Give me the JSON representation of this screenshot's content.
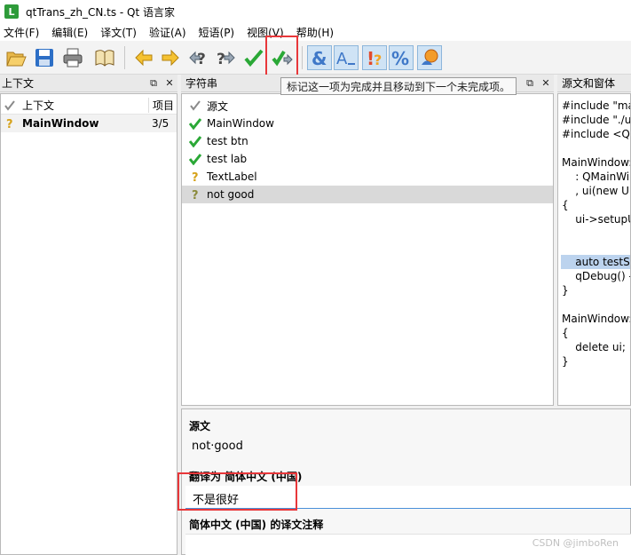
{
  "window": {
    "app_icon_letter": "L",
    "title": "qtTrans_zh_CN.ts - Qt 语言家"
  },
  "menu": [
    "文件(F)",
    "编辑(E)",
    "译文(T)",
    "验证(A)",
    "短语(P)",
    "视图(V)",
    "帮助(H)"
  ],
  "toolbar": {
    "buttons": [
      "open-icon",
      "save-icon",
      "print-icon",
      "phrasebook-icon",
      "prev-arrow-icon",
      "next-arrow-icon",
      "prev-unfinished-icon",
      "next-unfinished-icon",
      "done-icon",
      "done-and-next-icon",
      "accelerator-check-icon",
      "punctuation-check-icon",
      "phrase-check-icon",
      "placeholder-check-icon",
      "surrounding-whitespace-icon"
    ],
    "tooltip": "标记这一项为完成并且移动到下一个未完成项。"
  },
  "context_pane": {
    "title": "上下文",
    "columns": [
      "上下文",
      "项目"
    ],
    "rows": [
      {
        "icon": "question-icon",
        "name": "MainWindow",
        "count": "3/5"
      }
    ]
  },
  "strings_pane": {
    "title": "字符串",
    "header": "源文",
    "rows": [
      {
        "icon": "check-icon",
        "text": "MainWindow"
      },
      {
        "icon": "check-icon",
        "text": "test btn"
      },
      {
        "icon": "check-icon",
        "text": "test lab"
      },
      {
        "icon": "question-icon",
        "text": "TextLabel"
      },
      {
        "icon": "question-icon",
        "text": "not good",
        "selected": true
      }
    ]
  },
  "sources_pane": {
    "title": "源文和窗体",
    "lines": [
      "#include \"mai",
      "#include \"./ui_",
      "#include <QD",
      "",
      "MainWindow:",
      "    : QMainWi",
      "    , ui(new Ui:",
      "{",
      "    ui->setupU",
      "",
      "",
      "    auto testSt",
      "    qDebug() -",
      "}",
      "",
      "MainWindow:",
      "{",
      "    delete ui;",
      "}"
    ],
    "highlight_line": 11
  },
  "editor": {
    "source_label": "源文",
    "source_text": "not·good",
    "translation_label": "翻译为 简体中文 (中国)",
    "translation_value": "不是很好",
    "comment_label": "简体中文 (中国) 的译文注释"
  },
  "colors": {
    "check": "#2aa836",
    "question": "#d6a21a",
    "annotation": "#e8373a"
  },
  "watermark": "CSDN @jimboRen"
}
